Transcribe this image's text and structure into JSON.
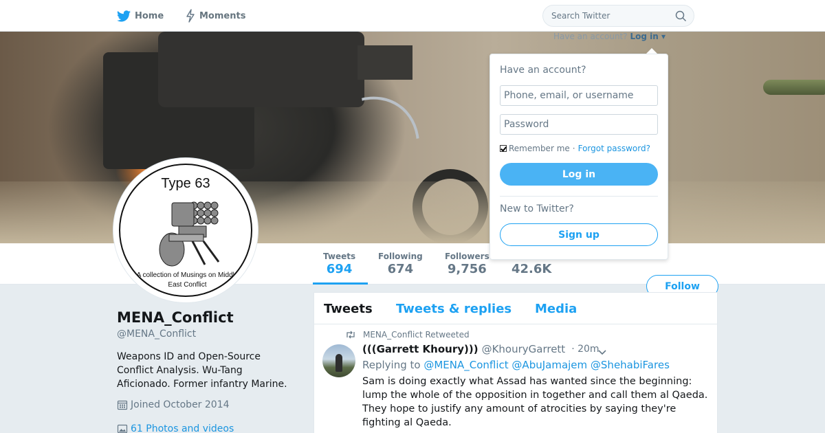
{
  "nav": {
    "home_label": "Home",
    "moments_label": "Moments",
    "search_placeholder": "Search Twitter"
  },
  "login_hint": {
    "text": "Have an account?",
    "link": "Log in ▾"
  },
  "dropdown": {
    "title": "Have an account?",
    "username_placeholder": "Phone, email, or username",
    "password_placeholder": "Password",
    "remember_label": "Remember me",
    "separator": "·",
    "forgot_label": "Forgot password?",
    "login_button": "Log in",
    "new_label": "New to Twitter?",
    "signup_button": "Sign up"
  },
  "avatar": {
    "title": "Type 63",
    "caption": "A collection of Musings on Middle East Conflict"
  },
  "stats": {
    "tweets": {
      "label": "Tweets",
      "value": "694"
    },
    "following": {
      "label": "Following",
      "value": "674"
    },
    "followers": {
      "label": "Followers",
      "value": "9,756"
    },
    "likes": {
      "value": "42.6K"
    }
  },
  "follow_button": "Follow",
  "profile": {
    "name": "MENA_Conflict",
    "handle": "@MENA_Conflict",
    "bio": "Weapons ID and Open-Source Conflict Analysis. Wu-Tang Aficionado. Former infantry Marine.",
    "joined": "Joined October 2014",
    "photos": "61 Photos and videos"
  },
  "timeline": {
    "tabs": [
      "Tweets",
      "Tweets & replies",
      "Media"
    ],
    "tweet": {
      "retweet_label": "MENA_Conflict Retweeted",
      "name": "(((Garrett Khoury)))",
      "username": "@KhouryGarrett",
      "time": "· 20m",
      "replying_prefix": "Replying to",
      "replying_to": "@MENA_Conflict @AbuJamajem @ShehabiFares",
      "text": "Sam is doing exactly what Assad has wanted since the beginning: lump the whole of the opposition in together and call them al Qaeda. They hope to justify any amount of atrocities by saying they're fighting al Qaeda."
    }
  },
  "colors": {
    "accent": "#1da1f2",
    "link": "#1b95e0",
    "muted": "#657786",
    "background": "#e6ecf0"
  },
  "icons": {
    "home": "twitter-bird-icon",
    "moments": "lightning-icon",
    "search": "search-icon",
    "joined": "calendar-icon",
    "photos": "image-icon",
    "retweet": "retweet-icon",
    "caret": "chevron-down-icon"
  }
}
